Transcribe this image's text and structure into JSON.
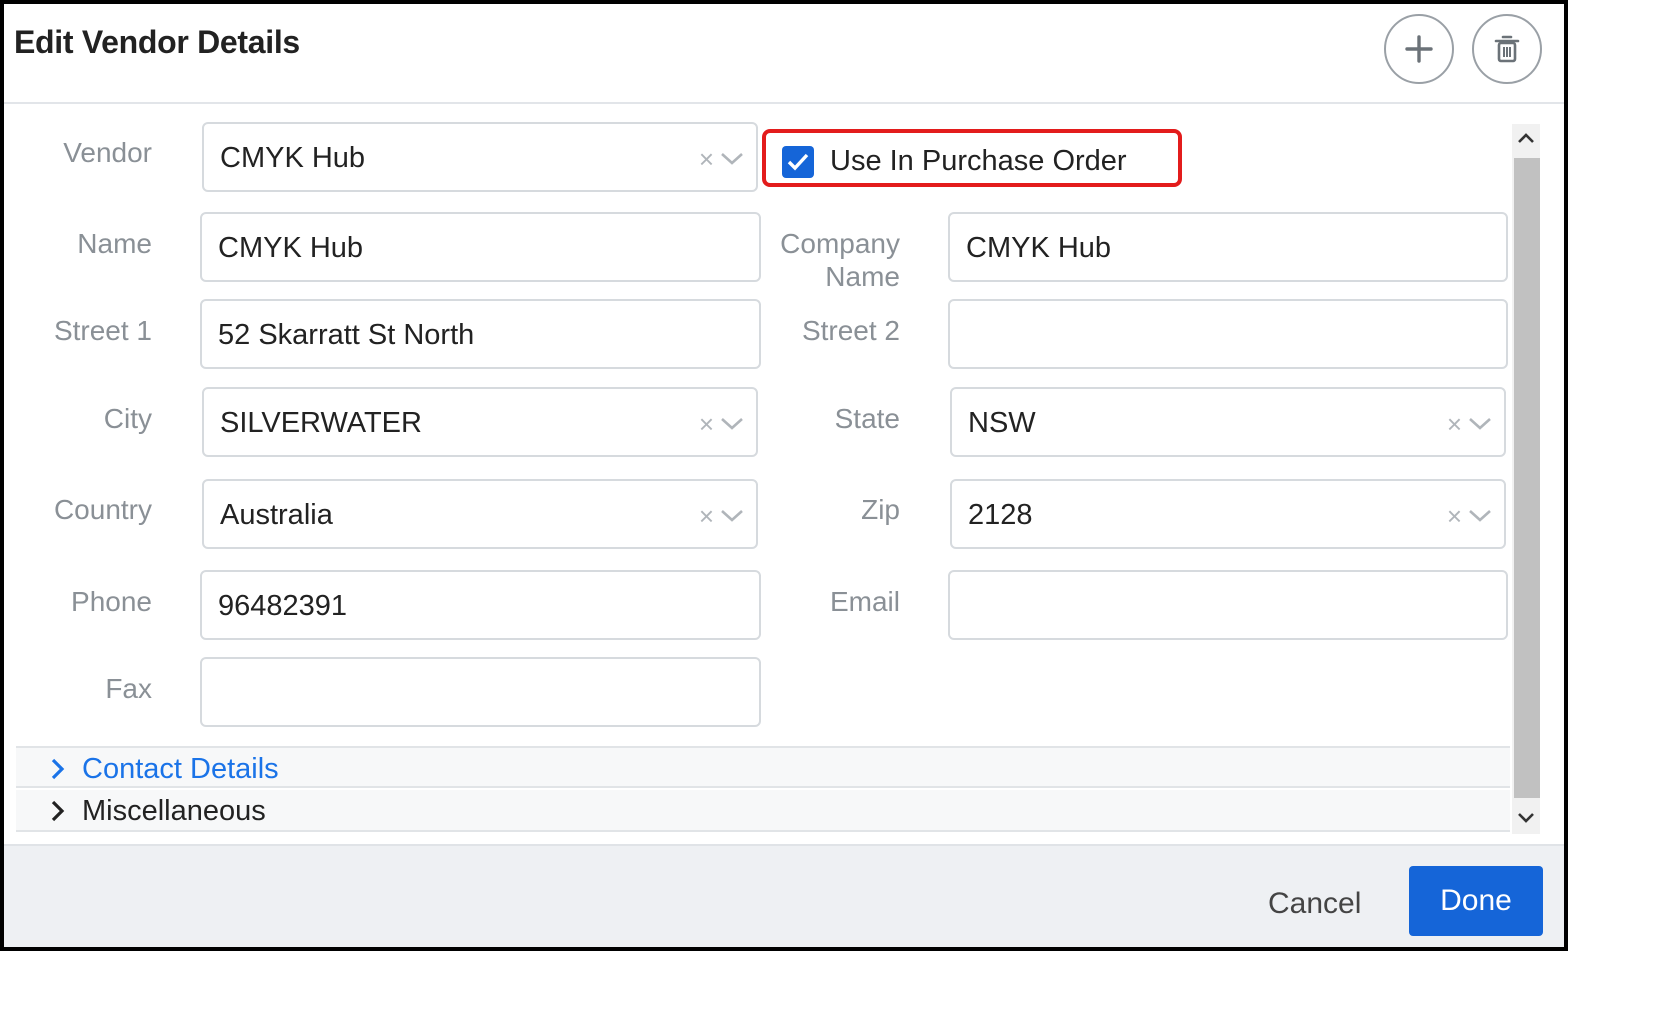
{
  "dialog": {
    "title": "Edit Vendor Details",
    "add_icon": "plus-icon",
    "delete_icon": "trash-icon"
  },
  "form": {
    "vendor": {
      "label": "Vendor",
      "value": "CMYK Hub"
    },
    "use_in_po": {
      "label": "Use In Purchase Order",
      "checked": true
    },
    "name": {
      "label": "Name",
      "value": "CMYK Hub"
    },
    "company_name": {
      "label_line1": "Company",
      "label_line2": "Name",
      "value": "CMYK Hub"
    },
    "street1": {
      "label": "Street 1",
      "value": "52 Skarratt St North"
    },
    "street2": {
      "label": "Street 2",
      "value": ""
    },
    "city": {
      "label": "City",
      "value": "SILVERWATER"
    },
    "state": {
      "label": "State",
      "value": "NSW"
    },
    "country": {
      "label": "Country",
      "value": "Australia"
    },
    "zip": {
      "label": "Zip",
      "value": "2128"
    },
    "phone": {
      "label": "Phone",
      "value": "96482391"
    },
    "email": {
      "label": "Email",
      "value": ""
    },
    "fax": {
      "label": "Fax",
      "value": ""
    }
  },
  "sections": [
    {
      "label": "Contact Details",
      "color": "#1a73e8"
    },
    {
      "label": "Miscellaneous",
      "color": "#222222"
    }
  ],
  "footer": {
    "cancel_label": "Cancel",
    "done_label": "Done"
  },
  "colors": {
    "accent": "#1565d8",
    "highlight": "#e31c1c"
  }
}
